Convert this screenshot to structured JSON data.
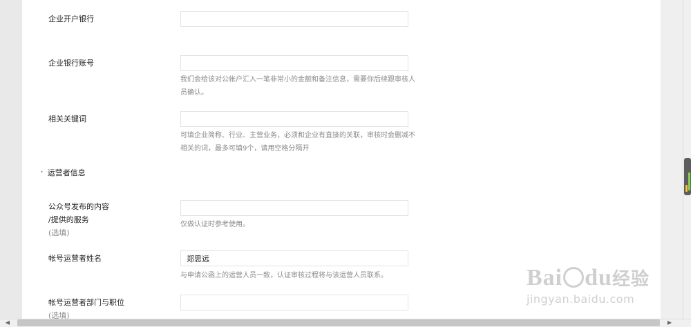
{
  "form": {
    "bank_name": {
      "label": "企业开户银行",
      "value": ""
    },
    "bank_account": {
      "label": "企业银行账号",
      "value": "",
      "hint": "我们会给该对公帐户汇入一笔非常小的金额和备注信息，需要你后续跟审核人员确认。"
    },
    "keywords": {
      "label": "相关关键词",
      "value": "",
      "hint": "可填企业简称、行业、主营业务，必须和企业有直接的关联，审核时会删减不相关的词，最多可填9个，请用空格分隔开"
    },
    "section_operator": "运营者信息",
    "content_service": {
      "label_line1": "公众号发布的内容",
      "label_line2": "/提供的服务",
      "optional": "(选填)",
      "value": "",
      "hint": "仅做认证时参考使用。"
    },
    "operator_name": {
      "label": "帐号运营者姓名",
      "value": "郑思远",
      "hint": "与申请公函上的运营人员一致，认证审核过程将与该运营人员联系。"
    },
    "operator_dept": {
      "label": "帐号运营者部门与职位",
      "optional": "(选填)",
      "value": ""
    }
  },
  "watermark": {
    "logo_left": "Bai",
    "logo_right": "du",
    "logo_cn": "经验",
    "url": "jingyan.baidu.com"
  }
}
